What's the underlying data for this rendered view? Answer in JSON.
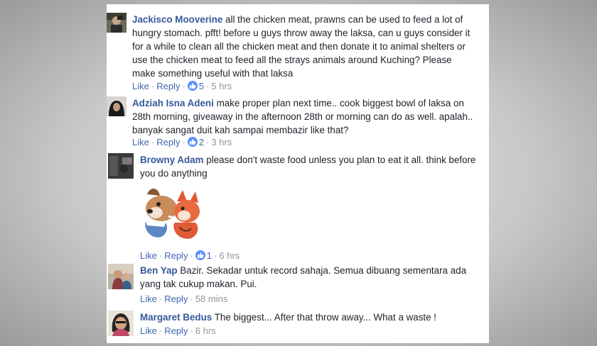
{
  "comments": [
    {
      "author": "Jackisco Mooverine",
      "text": "all the chicken meat, prawns can be used to feed a lot of hungry stomach. pfft! before u guys throw away the laksa, can u guys consider it for a while to clean all the chicken meat and then donate it to animal shelters or use the chicken meat to feed all the strays animals around Kuching? Please make something useful with that laksa",
      "like_label": "Like",
      "reply_label": "Reply",
      "reactions": "5",
      "time": "5 hrs"
    },
    {
      "author": "Adziah Isna Adeni",
      "text": "make proper plan next time.. cook biggest bowl of laksa on 28th morning, giveaway in the afternoon 28th or morning can do as well. apalah.. banyak sangat duit kah sampai membazir like that?",
      "like_label": "Like",
      "reply_label": "Reply",
      "reactions": "2",
      "time": "3 hrs"
    },
    {
      "author": "Browny Adam",
      "text": "please don't waste food unless you plan to eat it all. think before you do anything",
      "like_label": "Like",
      "reply_label": "Reply",
      "reactions": "1",
      "time": "6 hrs"
    },
    {
      "author": "Ben Yap",
      "text": "Bazir. Sekadar untuk record sahaja. Semua dibuang sementara ada yang tak cukup makan. Pui.",
      "like_label": "Like",
      "reply_label": "Reply",
      "time": "58 mins"
    },
    {
      "author": "Margaret Bedus",
      "text": "The biggest... After that throw away... What a waste !",
      "like_label": "Like",
      "reply_label": "Reply",
      "time": "6 hrs"
    }
  ],
  "colors": {
    "author": "#365899",
    "link": "#4267b2",
    "meta": "#90949c",
    "text": "#1d2129",
    "like_badge": "#5890ff"
  },
  "icons": {
    "reaction": "thumbs-up-icon",
    "sticker": "dog-and-fox-hug-sticker"
  }
}
